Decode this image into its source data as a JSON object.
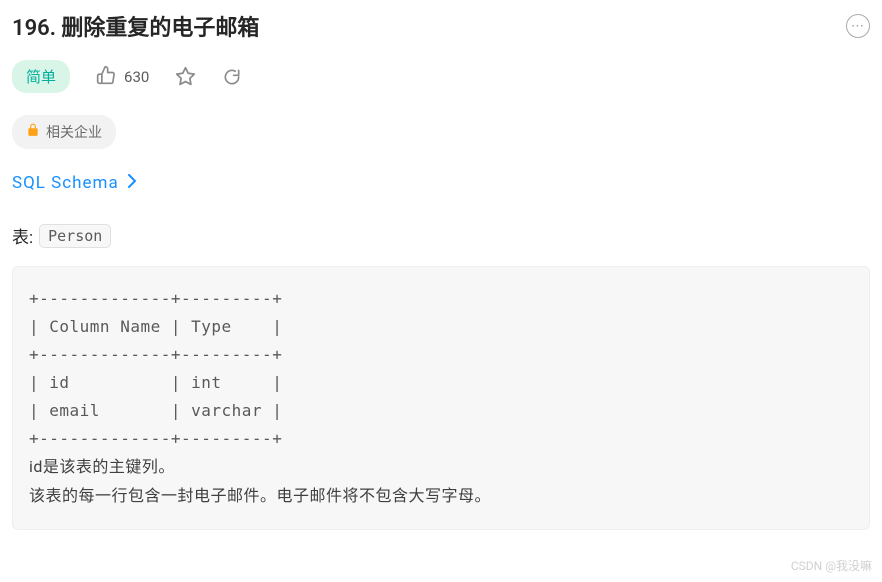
{
  "header": {
    "title": "196. 删除重复的电子邮箱"
  },
  "meta": {
    "difficulty": "简单",
    "like_count": "630"
  },
  "tags": {
    "company_label": "相关企业"
  },
  "schema": {
    "link_text": "SQL Schema"
  },
  "table_intro": {
    "prefix": "表:",
    "name": "Person"
  },
  "schema_block": "+-------------+---------+\n| Column Name | Type    |\n+-------------+---------+\n| id          | int     |\n| email       | varchar |\n+-------------+---------+",
  "description": {
    "line1": "id是该表的主键列。",
    "line2": "该表的每一行包含一封电子邮件。电子邮件将不包含大写字母。"
  },
  "watermark": "CSDN @我没嘛"
}
